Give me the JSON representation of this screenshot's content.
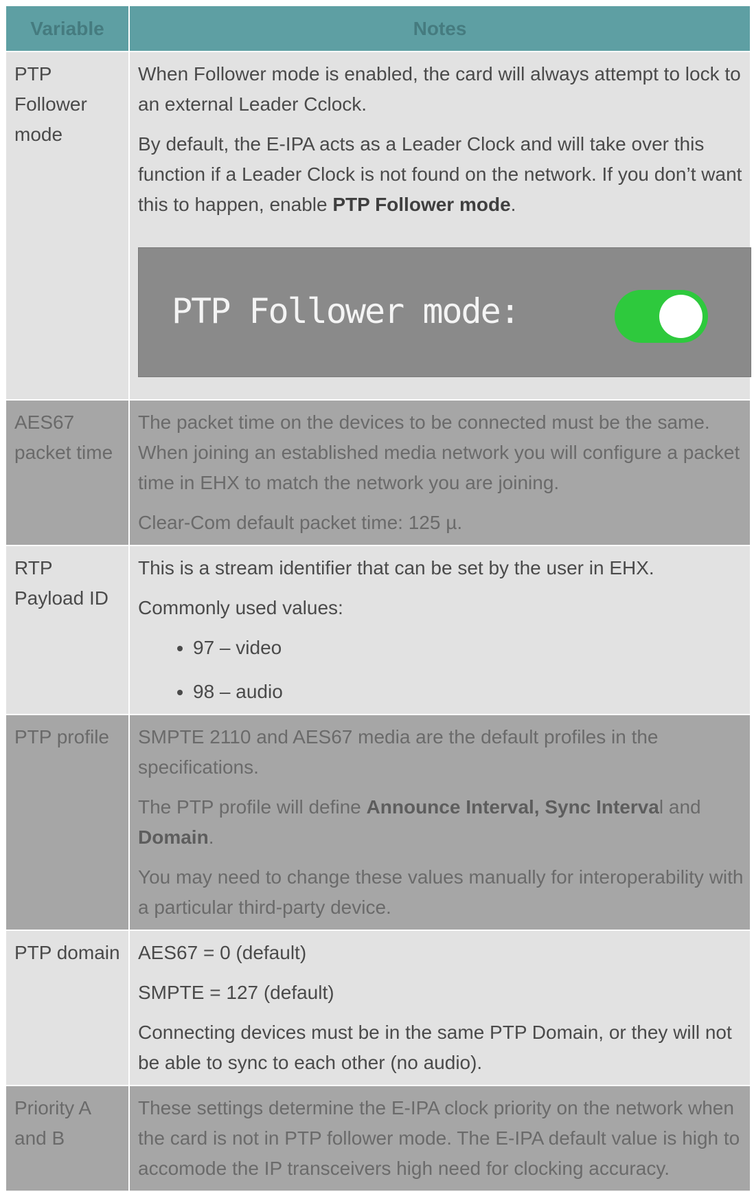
{
  "header": {
    "variable": "Variable",
    "notes": "Notes"
  },
  "rows": {
    "ptp_follower": {
      "variable": "PTP Follower mode",
      "p1": "When Follower mode is enabled, the card will always attempt to lock to an external Leader Cclock.",
      "p2_pre": "By default, the E-IPA acts as a Leader Clock and will take over this function if a Leader Clock is not found on the network. If you don’t want this to happen, enable ",
      "p2_bold": "PTP Follower mode",
      "p2_post": ".",
      "toggle_label": "PTP Follower mode:",
      "toggle_state": "on",
      "toggle_color": "#2ec93d"
    },
    "aes67_packet": {
      "variable": "AES67 packet time",
      "p1": "The packet time on the devices to be connected must be the same. When joining an established media network you will configure a packet time in EHX to match the network you are joining.",
      "p2": "Clear-Com default packet time: 125 µ."
    },
    "rtp_payload": {
      "variable": "RTP Payload ID",
      "p1": "This is a stream identifier that can be set by the user in EHX.",
      "p2": "Commonly used values:",
      "items": [
        "97 – video",
        "98 – audio"
      ]
    },
    "ptp_profile": {
      "variable": "PTP profile",
      "p1": "SMPTE 2110 and AES67 media are the default profiles in the specifications.",
      "p2_pre": "The PTP profile will define ",
      "p2_bold1": "Announce Interval, Sync Interva",
      "p2_mid": "l and ",
      "p2_bold2": "Domain",
      "p2_post": ".",
      "p3": "You may need to change these values manually for interoperability with a particular third-party device."
    },
    "ptp_domain": {
      "variable": "PTP domain",
      "p1": "AES67 = 0 (default)",
      "p2": "SMPTE = 127 (default)",
      "p3": "Connecting devices must be in the same PTP Domain, or they will not be able to sync to each other (no audio)."
    },
    "priority": {
      "variable": "Priority A and B",
      "p1": "These settings determine the E-IPA clock priority on the network when the card is not in PTP follower mode. The E-IPA default value is high to accomode the IP transceivers high need for clocking accuracy."
    }
  }
}
